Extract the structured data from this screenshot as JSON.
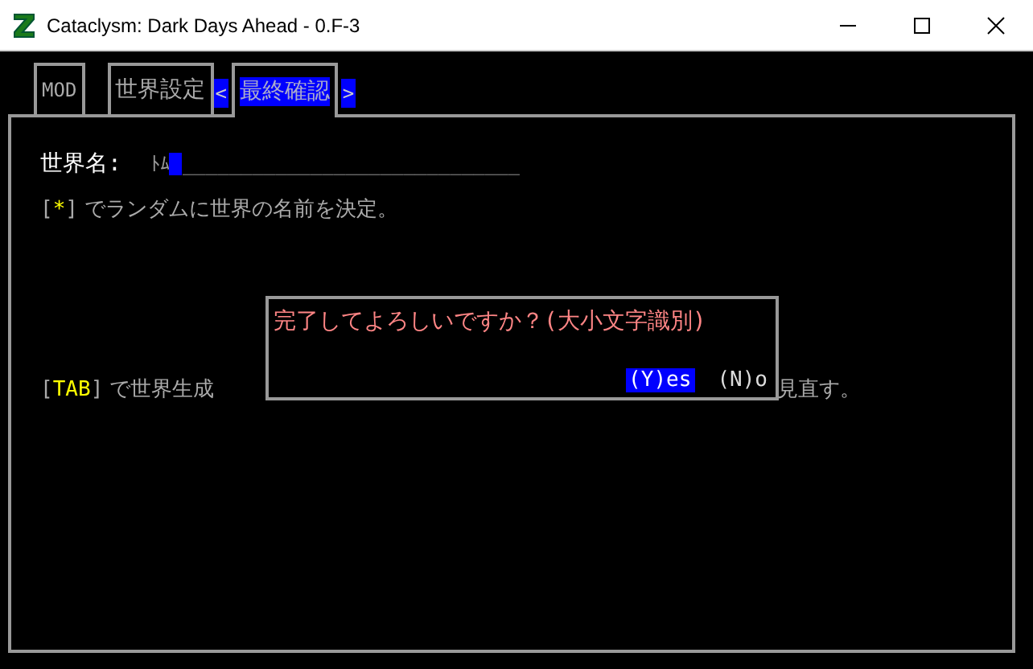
{
  "window": {
    "title": "Cataclysm: Dark Days Ahead - 0.F-3"
  },
  "tabs": [
    {
      "kind": "tab",
      "label": "MOD",
      "selected": false
    },
    {
      "kind": "tab",
      "label": "世界設定",
      "selected": false
    },
    {
      "kind": "arrow",
      "label": "<"
    },
    {
      "kind": "tab",
      "label": "最終確認",
      "selected": true
    },
    {
      "kind": "arrow",
      "label": ">"
    }
  ],
  "name_field": {
    "label": "世界名:",
    "value": "ﾄﾑ",
    "fill": "_____________________________"
  },
  "random_hint": {
    "open": "[",
    "key": "*",
    "close": "]",
    "text": "でランダムに世界の名前を決定。"
  },
  "tab_hint": {
    "open": "[",
    "key": "TAB",
    "close": "]",
    "text": "で世界生成",
    "text_after": "見直す。"
  },
  "dialog": {
    "message": "完了してよろしいですか？(大小文字識別)",
    "options": [
      {
        "label": "(Y)es",
        "selected": true
      },
      {
        "label": "(N)o",
        "selected": false
      }
    ]
  }
}
